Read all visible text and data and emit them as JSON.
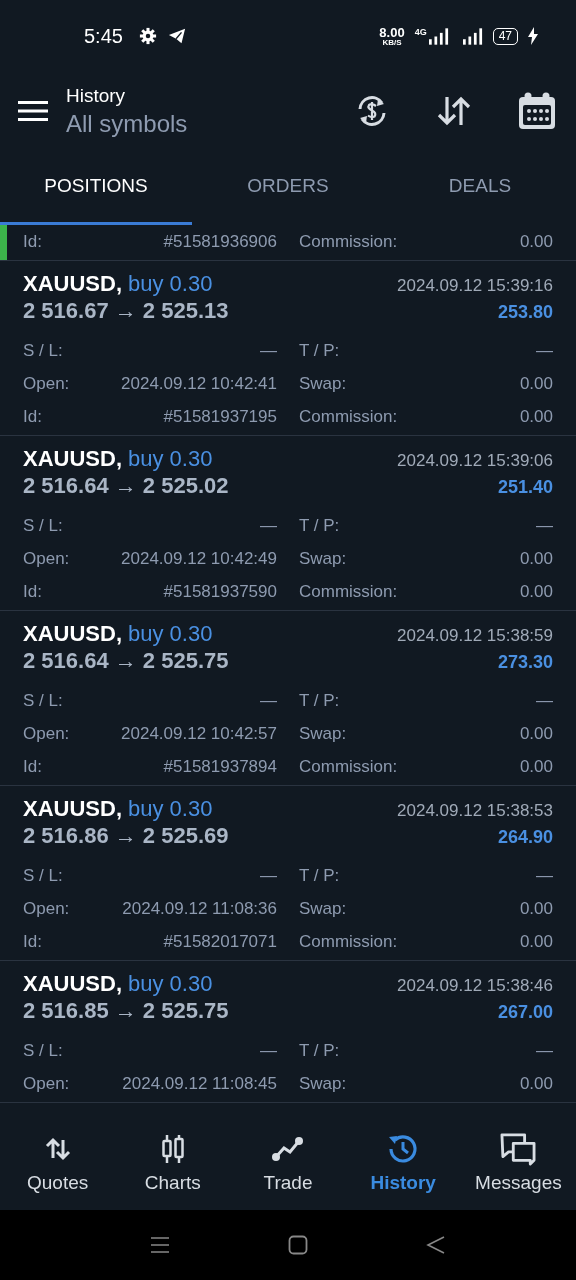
{
  "status_bar": {
    "time": "5:45",
    "net_speed": "8.00",
    "net_unit": "KB/S",
    "network": "4G",
    "battery": "47"
  },
  "header": {
    "title": "History",
    "subtitle": "All symbols"
  },
  "tabs": [
    {
      "label": "POSITIONS",
      "selected": true
    },
    {
      "label": "ORDERS",
      "selected": false
    },
    {
      "label": "DEALS",
      "selected": false
    }
  ],
  "positions": [
    {
      "marked": true,
      "rows": [
        {
          "label": "Id:",
          "value": "#51581936906",
          "label2": "Commission:",
          "value2": "0.00"
        }
      ]
    },
    {
      "marked": false,
      "symbol": "XAUUSD,",
      "side": "buy 0.30",
      "time": "2024.09.12 15:39:16",
      "prices": "2 516.67 → 2 525.13",
      "profit": "253.80",
      "rows": [
        {
          "label": "S / L:",
          "value": "—",
          "label2": "T / P:",
          "value2": "—"
        },
        {
          "label": "Open:",
          "value": "2024.09.12 10:42:41",
          "label2": "Swap:",
          "value2": "0.00"
        },
        {
          "label": "Id:",
          "value": "#51581937195",
          "label2": "Commission:",
          "value2": "0.00"
        }
      ]
    },
    {
      "marked": false,
      "symbol": "XAUUSD,",
      "side": "buy 0.30",
      "time": "2024.09.12 15:39:06",
      "prices": "2 516.64 → 2 525.02",
      "profit": "251.40",
      "rows": [
        {
          "label": "S / L:",
          "value": "—",
          "label2": "T / P:",
          "value2": "—"
        },
        {
          "label": "Open:",
          "value": "2024.09.12 10:42:49",
          "label2": "Swap:",
          "value2": "0.00"
        },
        {
          "label": "Id:",
          "value": "#51581937590",
          "label2": "Commission:",
          "value2": "0.00"
        }
      ]
    },
    {
      "marked": false,
      "symbol": "XAUUSD,",
      "side": "buy 0.30",
      "time": "2024.09.12 15:38:59",
      "prices": "2 516.64 → 2 525.75",
      "profit": "273.30",
      "rows": [
        {
          "label": "S / L:",
          "value": "—",
          "label2": "T / P:",
          "value2": "—"
        },
        {
          "label": "Open:",
          "value": "2024.09.12 10:42:57",
          "label2": "Swap:",
          "value2": "0.00"
        },
        {
          "label": "Id:",
          "value": "#51581937894",
          "label2": "Commission:",
          "value2": "0.00"
        }
      ]
    },
    {
      "marked": false,
      "symbol": "XAUUSD,",
      "side": "buy 0.30",
      "time": "2024.09.12 15:38:53",
      "prices": "2 516.86 → 2 525.69",
      "profit": "264.90",
      "rows": [
        {
          "label": "S / L:",
          "value": "—",
          "label2": "T / P:",
          "value2": "—"
        },
        {
          "label": "Open:",
          "value": "2024.09.12 11:08:36",
          "label2": "Swap:",
          "value2": "0.00"
        },
        {
          "label": "Id:",
          "value": "#51582017071",
          "label2": "Commission:",
          "value2": "0.00"
        }
      ]
    },
    {
      "marked": false,
      "symbol": "XAUUSD,",
      "side": "buy 0.30",
      "time": "2024.09.12 15:38:46",
      "prices": "2 516.85 → 2 525.75",
      "profit": "267.00",
      "rows": [
        {
          "label": "S / L:",
          "value": "—",
          "label2": "T / P:",
          "value2": "—"
        },
        {
          "label": "Open:",
          "value": "2024.09.12 11:08:45",
          "label2": "Swap:",
          "value2": "0.00"
        }
      ]
    }
  ],
  "bottom_nav": [
    {
      "label": "Quotes",
      "kind": "quotes",
      "selected": false
    },
    {
      "label": "Charts",
      "kind": "charts",
      "selected": false
    },
    {
      "label": "Trade",
      "kind": "trade",
      "selected": false
    },
    {
      "label": "History",
      "kind": "history",
      "selected": true
    },
    {
      "label": "Messages",
      "kind": "messages",
      "selected": false
    }
  ]
}
